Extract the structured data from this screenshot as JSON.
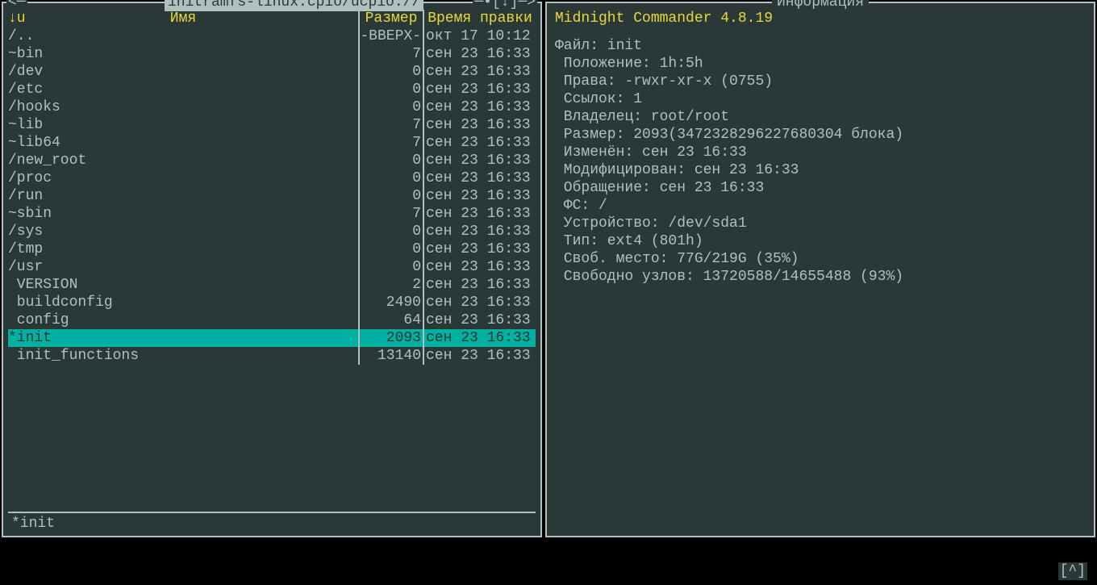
{
  "left": {
    "path_title": " initramfs-linux.cpio/ucpio:// ",
    "arrow_left": "<─",
    "arrow_right": "─•[↓]─>",
    "sort_indicator": "↓u",
    "col_name": "Имя",
    "col_size": "Размер",
    "col_time": "Время правки",
    "rows": [
      {
        "name": "/..",
        "size": "-ВВЕРХ-",
        "time": "окт 17 10:12",
        "selected": false
      },
      {
        "name": "~bin",
        "size": "7",
        "time": "сен 23 16:33",
        "selected": false
      },
      {
        "name": "/dev",
        "size": "0",
        "time": "сен 23 16:33",
        "selected": false
      },
      {
        "name": "/etc",
        "size": "0",
        "time": "сен 23 16:33",
        "selected": false
      },
      {
        "name": "/hooks",
        "size": "0",
        "time": "сен 23 16:33",
        "selected": false
      },
      {
        "name": "~lib",
        "size": "7",
        "time": "сен 23 16:33",
        "selected": false
      },
      {
        "name": "~lib64",
        "size": "7",
        "time": "сен 23 16:33",
        "selected": false
      },
      {
        "name": "/new_root",
        "size": "0",
        "time": "сен 23 16:33",
        "selected": false
      },
      {
        "name": "/proc",
        "size": "0",
        "time": "сен 23 16:33",
        "selected": false
      },
      {
        "name": "/run",
        "size": "0",
        "time": "сен 23 16:33",
        "selected": false
      },
      {
        "name": "~sbin",
        "size": "7",
        "time": "сен 23 16:33",
        "selected": false
      },
      {
        "name": "/sys",
        "size": "0",
        "time": "сен 23 16:33",
        "selected": false
      },
      {
        "name": "/tmp",
        "size": "0",
        "time": "сен 23 16:33",
        "selected": false
      },
      {
        "name": "/usr",
        "size": "0",
        "time": "сен 23 16:33",
        "selected": false
      },
      {
        "name": " VERSION",
        "size": "2",
        "time": "сен 23 16:33",
        "selected": false
      },
      {
        "name": " buildconfig",
        "size": "2490",
        "time": "сен 23 16:33",
        "selected": false
      },
      {
        "name": " config",
        "size": "64",
        "time": "сен 23 16:33",
        "selected": false
      },
      {
        "name": "*init",
        "size": "2093",
        "time": "сен 23 16:33",
        "selected": true
      },
      {
        "name": " init_functions",
        "size": "13140",
        "time": "сен 23 16:33",
        "selected": false
      }
    ],
    "mini_status": "*init"
  },
  "right": {
    "title": " Информация ",
    "heading": "Midnight Commander 4.8.19",
    "lines": [
      "Файл: init",
      " Положение: 1h:5h",
      " Права: -rwxr-xr-x (0755)",
      " Ссылок: 1",
      " Владелец: root/root",
      " Размер: 2093(3472328296227680304 блока)",
      " Изменён: сен 23 16:33",
      " Модифицирован: сен 23 16:33",
      " Обращение: сен 23 16:33",
      " ФС: /",
      " Устройство: /dev/sda1",
      " Тип: ext4 (801h)",
      " Своб. место: 77G/219G (35%)",
      " Свободно узлов: 13720588/14655488 (93%)"
    ]
  },
  "caret": "[^]"
}
